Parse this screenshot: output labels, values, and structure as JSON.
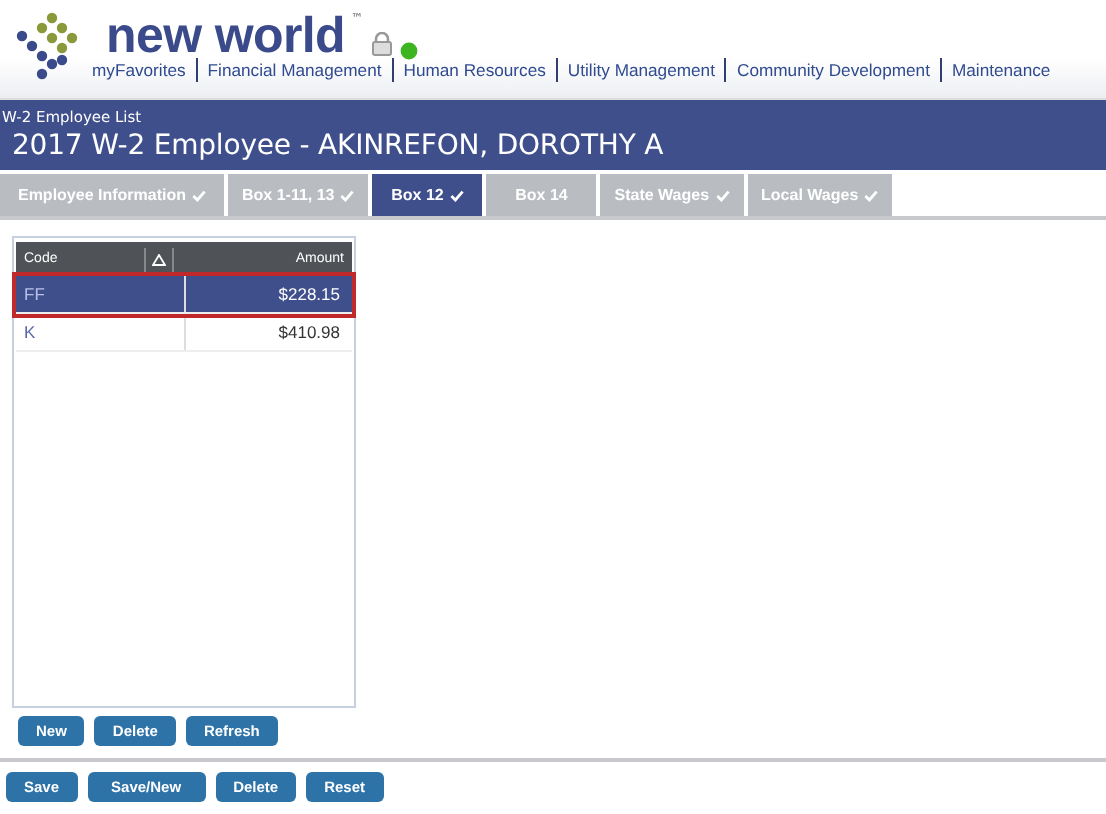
{
  "header": {
    "logo": "new world",
    "trademark": "™",
    "nav": [
      "myFavorites",
      "Financial Management",
      "Human Resources",
      "Utility Management",
      "Community Development",
      "Maintenance"
    ]
  },
  "banner": {
    "breadcrumb": "W-2 Employee List",
    "title": "2017 W-2 Employee - AKINREFON, DOROTHY A"
  },
  "tabs": [
    {
      "label": "Employee Information",
      "checked": true,
      "selected": false
    },
    {
      "label": "Box 1-11, 13",
      "checked": true,
      "selected": false
    },
    {
      "label": "Box 12",
      "checked": true,
      "selected": true
    },
    {
      "label": "Box 14",
      "checked": false,
      "selected": false
    },
    {
      "label": "State Wages",
      "checked": true,
      "selected": false
    },
    {
      "label": "Local Wages",
      "checked": true,
      "selected": false
    }
  ],
  "table": {
    "columns": [
      "Code",
      "Amount"
    ],
    "rows": [
      {
        "code": "FF",
        "amount": "$228.15",
        "selected": true
      },
      {
        "code": "K",
        "amount": "$410.98",
        "selected": false
      }
    ]
  },
  "grid_buttons": [
    "New",
    "Delete",
    "Refresh"
  ],
  "form_buttons": [
    "Save",
    "Save/New",
    "Delete",
    "Reset"
  ]
}
